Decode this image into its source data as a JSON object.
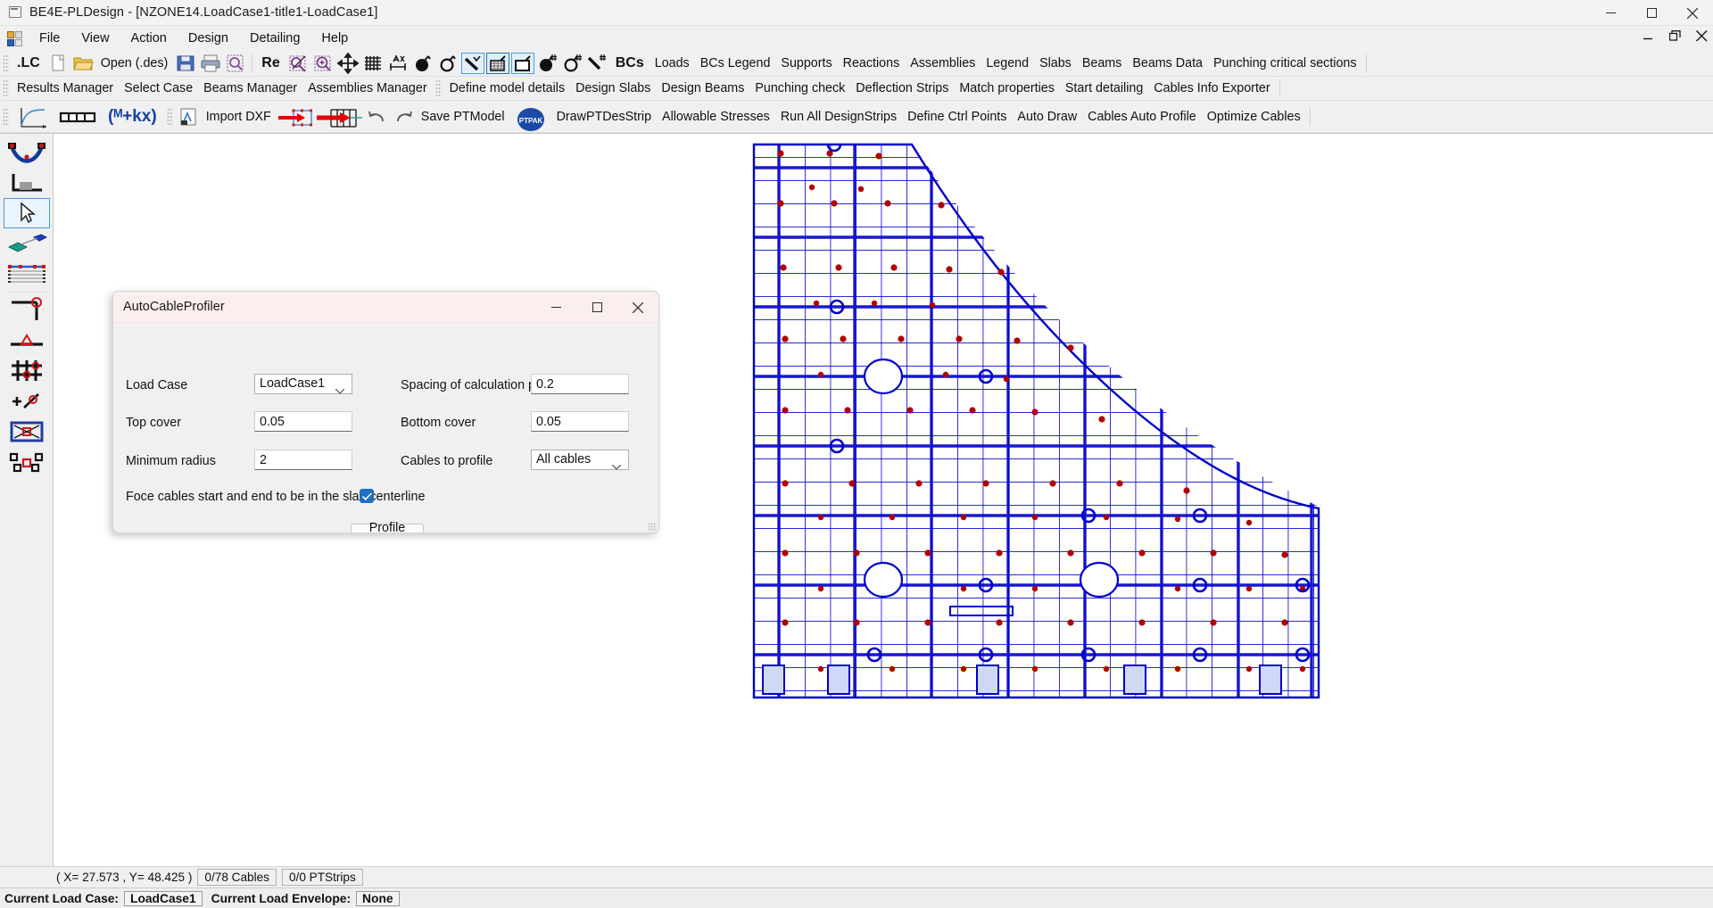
{
  "window": {
    "title": "BE4E-PLDesign - [NZONE14.LoadCase1-title1-LoadCase1]",
    "app_icon": "app-window-icon",
    "minimize": "—",
    "maximize": "□",
    "close": "✕"
  },
  "menu": {
    "items": [
      {
        "label": "File"
      },
      {
        "label": "View"
      },
      {
        "label": "Action"
      },
      {
        "label": "Design"
      },
      {
        "label": "Detailing"
      },
      {
        "label": "Help"
      }
    ]
  },
  "toolbar_row1": {
    "lc_label": ".LC",
    "open_label": "Open (.des)",
    "re_label": "Re",
    "bcs_label": "BCs",
    "text_buttons": [
      {
        "label": "Loads"
      },
      {
        "label": "BCs Legend"
      },
      {
        "label": "Supports"
      },
      {
        "label": "Reactions"
      },
      {
        "label": "Assemblies"
      },
      {
        "label": "Legend"
      },
      {
        "label": "Slabs"
      },
      {
        "label": "Beams"
      },
      {
        "label": "Beams Data"
      },
      {
        "label": "Punching critical sections"
      }
    ],
    "icons": [
      {
        "name": "new-document-icon"
      },
      {
        "name": "open-folder-icon"
      },
      {
        "name": "save-floppy-icon"
      },
      {
        "name": "print-icon"
      },
      {
        "name": "print-preview-icon"
      },
      {
        "name": "zoom-extents-icon"
      },
      {
        "name": "zoom-window-icon"
      },
      {
        "name": "pan-icon"
      },
      {
        "name": "mesh-grid-icon"
      },
      {
        "name": "dimension-icon"
      },
      {
        "name": "node-solid-icon"
      },
      {
        "name": "node-hollow-icon"
      },
      {
        "name": "line-element-icon"
      },
      {
        "name": "slab-mesh-icon"
      },
      {
        "name": "slab-outline-icon"
      },
      {
        "name": "node-solid-hash-icon"
      },
      {
        "name": "node-hollow-hash-icon"
      },
      {
        "name": "line-hash-icon"
      }
    ]
  },
  "toolbar_row2": {
    "group1": [
      {
        "label": "Results Manager"
      },
      {
        "label": "Select Case"
      },
      {
        "label": "Beams Manager"
      },
      {
        "label": "Assemblies Manager"
      }
    ],
    "group2": [
      {
        "label": "Define model details"
      },
      {
        "label": "Design Slabs"
      },
      {
        "label": "Design Beams"
      },
      {
        "label": "Punching check"
      },
      {
        "label": "Deflection Strips"
      },
      {
        "label": "Match properties"
      },
      {
        "label": "Start detailing"
      },
      {
        "label": "Cables Info Exporter"
      }
    ]
  },
  "toolbar_row3": {
    "import_dxf_label": "Import DXF",
    "save_ptmodel_label": "Save PTModel",
    "ptpak_label": "PTPAK",
    "formula_label": "(ᴹ+kx)",
    "text_buttons": [
      {
        "label": "DrawPTDesStrip"
      },
      {
        "label": "Allowable Stresses"
      },
      {
        "label": "Run All DesignStrips"
      },
      {
        "label": "Define Ctrl Points"
      },
      {
        "label": "Auto Draw"
      },
      {
        "label": "Cables Auto Profile"
      },
      {
        "label": "Optimize Cables"
      }
    ],
    "icons": [
      {
        "name": "stress-curve-chart-icon"
      },
      {
        "name": "tendon-segments-icon"
      },
      {
        "name": "import-dxf-icon"
      },
      {
        "name": "stretch-slab-icon"
      },
      {
        "name": "prestress-arrow-icon"
      },
      {
        "name": "undo-icon"
      },
      {
        "name": "redo-icon"
      }
    ]
  },
  "left_toolbar": {
    "items": [
      {
        "name": "cable-profile-icon"
      },
      {
        "name": "support-corner-icon"
      },
      {
        "name": "select-pointer-icon",
        "selected": true
      },
      {
        "name": "slab-draw-icon"
      },
      {
        "name": "design-strip-icon"
      },
      {
        "name": "control-point-icon"
      },
      {
        "name": "support-triangle-icon"
      },
      {
        "name": "mesh-nodes-icon"
      },
      {
        "name": "add-node-icon"
      },
      {
        "name": "punching-area-icon"
      },
      {
        "name": "column-nodes-icon"
      }
    ]
  },
  "dialog": {
    "title": "AutoCableProfiler",
    "minimize": "—",
    "maximize": "□",
    "close": "✕",
    "fields": {
      "load_case_label": "Load Case",
      "load_case_value": "LoadCase1",
      "load_case_options": [
        "LoadCase1"
      ],
      "spacing_label": "Spacing of calculation points",
      "spacing_value": "0.2",
      "top_cover_label": "Top cover",
      "top_cover_value": "0.05",
      "bottom_cover_label": "Bottom cover",
      "bottom_cover_value": "0.05",
      "minimum_radius_label": "Minimum radius",
      "minimum_radius_value": "2",
      "cables_to_profile_label": "Cables to profile",
      "cables_to_profile_value": "All cables",
      "cables_to_profile_options": [
        "All cables"
      ],
      "force_centerline_label": "Foce cables start and end to be in the slab centerline",
      "force_centerline_checked": true
    },
    "action_button": "Profile Cables"
  },
  "statusbar": {
    "coords": "( X= 27.573 , Y= 48.425 )",
    "cables": "0/78 Cables",
    "ptstrips": "0/0 PTStrips"
  },
  "statusbar2": {
    "load_case_label": "Current Load Case:",
    "load_case_value": "LoadCase1",
    "envelope_label": "Current Load Envelope:",
    "envelope_value": "None"
  },
  "colors": {
    "accent_blue": "#0000d0",
    "node_red": "#c00000",
    "dialog_title_bg": "#faeeee",
    "selection_blue": "#4a9ae0",
    "checkbox_blue": "#1f6ec2"
  },
  "canvas": {
    "name": "slab-model-drawing",
    "description": "Post-tensioned slab plan with blue grid of design strips and red nodes"
  }
}
